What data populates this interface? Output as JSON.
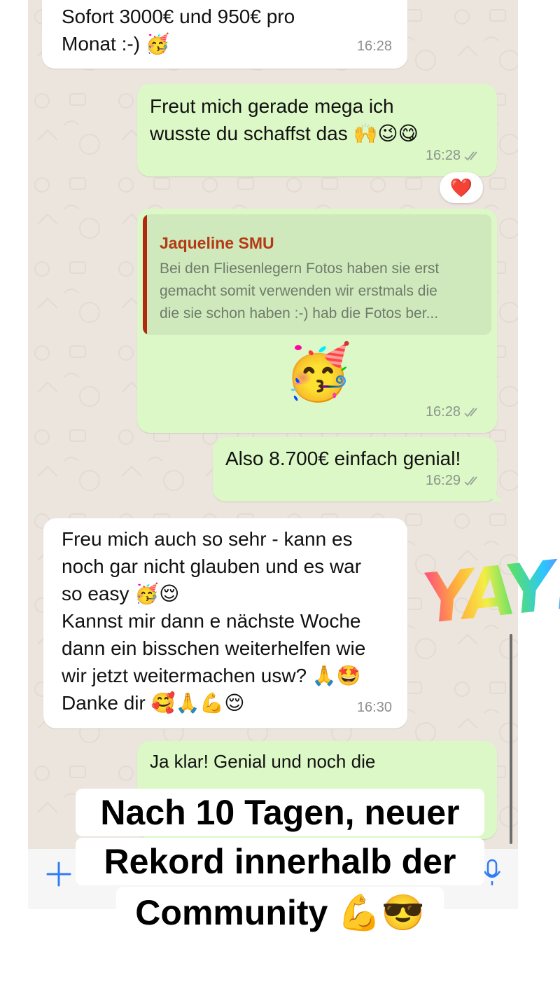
{
  "messages": [
    {
      "id": "m1",
      "direction": "incoming",
      "text": "Sofort 3000€ und 950€ pro\nMonat :-) 🥳",
      "time": "16:28"
    },
    {
      "id": "m2",
      "direction": "outgoing",
      "text": "Freut mich gerade mega ich\nwusste du schaffst das 🙌😉😋",
      "time": "16:28",
      "reaction": "❤️"
    },
    {
      "id": "m3",
      "direction": "outgoing",
      "quote_author": "Jaqueline SMU",
      "quote_text": "Bei den Fliesenlegern Fotos haben sie erst\ngemacht somit verwenden wir erstmals die\ndie sie schon haben :-) hab die Fotos ber...",
      "emoji": "🥳",
      "time": "16:28"
    },
    {
      "id": "m4",
      "direction": "outgoing",
      "text": "Also 8.700€ einfach genial!",
      "time": "16:29"
    },
    {
      "id": "m5",
      "direction": "incoming",
      "text": "Freu mich auch so sehr - kann es\nnoch gar nicht glauben und es war\nso easy 🥳😌\nKannst mir dann e nächste Woche\ndann ein bisschen weiterhelfen wie\nwir jetzt weitermachen usw? 🙏🤩\nDanke dir 🥰🙏💪😌",
      "time": "16:30"
    },
    {
      "id": "m6",
      "direction": "outgoing",
      "text": "Ja klar! Genial und noch die"
    }
  ],
  "sticker": {
    "text": "YAY!"
  },
  "caption": {
    "lines": [
      "Nach 10 Tagen, neuer",
      "Rekord innerhalb der",
      "Community 💪😎"
    ]
  },
  "colors": {
    "incoming": "#FFFFFF",
    "outgoing": "#DCF8C6",
    "chat_bg": "#ECE5DD",
    "quote_author": "#B33A12"
  },
  "icons": {
    "attach": "plus-icon",
    "voice": "mic-icon",
    "read_receipt": "double-check-icon"
  }
}
